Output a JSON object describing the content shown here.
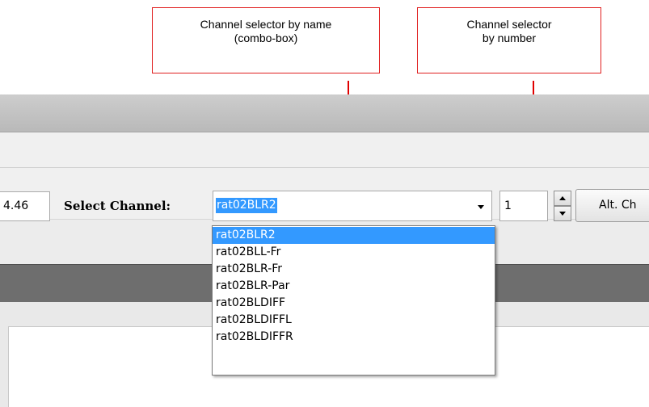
{
  "callouts": {
    "by_name": "Channel selector by name\n(combo-box)",
    "by_number": "Channel selector\nby number"
  },
  "toolbar": {
    "prev_value": "4.46",
    "select_channel_label": "Select Channel:",
    "channel_combo_value": "rat02BLR2",
    "channel_number_value": "1",
    "alt_button_label": "Alt. Ch"
  },
  "dropdown": {
    "items": [
      "rat02BLR2",
      "rat02BLL-Fr",
      "rat02BLR-Fr",
      "rat02BLR-Par",
      "rat02BLDIFF",
      "rat02BLDIFFL",
      "rat02BLDIFFR"
    ],
    "selected_index": 0
  },
  "colors": {
    "callout_red": "#e00000",
    "selection_blue": "#3399ff"
  }
}
